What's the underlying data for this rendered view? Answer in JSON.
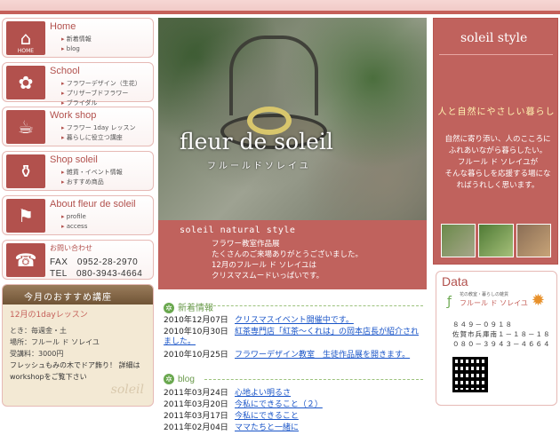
{
  "nav": [
    {
      "title": "Home",
      "icon": "house-icon",
      "icon_label": "HOME",
      "links": [
        "新着情報",
        "blog"
      ]
    },
    {
      "title": "School",
      "icon": "flower-icon",
      "icon_label": "",
      "links": [
        "フラワーデザイン（生花）",
        "プリザーブドフラワー",
        "ブライダル"
      ]
    },
    {
      "title": "Work shop",
      "icon": "cup-icon",
      "icon_label": "",
      "links": [
        "フラワー 1day レッスン",
        "暮らしに役立つ講座"
      ]
    },
    {
      "title": "Shop soleil",
      "icon": "watering-can-icon",
      "icon_label": "",
      "links": [
        "雑貨・イベント情報",
        "おすすめ商品"
      ]
    },
    {
      "title": "About fleur de soleil",
      "icon": "flag-icon",
      "icon_label": "",
      "links": [
        "profile",
        "access"
      ]
    }
  ],
  "contact": {
    "title": "お問い合わせ",
    "fax": "FAX　0952-28-2970",
    "tel": "TEL　080-3943-4664"
  },
  "course": {
    "heading": "今月のおすすめ講座",
    "title": "12月の1dayレッスン",
    "when": "とき：毎週金・土",
    "place": "場所：フルール ド ソレイユ",
    "fee": "受講料：3000円",
    "desc": "フレッシュもみの木でドア飾り！ 詳細はworkshopをご覧下さい",
    "watermark": "soleil"
  },
  "hero": {
    "title": "fleur de soleil",
    "subtitle": "フルールドソレイユ"
  },
  "natural": {
    "title": "soleil natural style",
    "lines": [
      "フラワー教室作品展",
      "たくさんのご来場ありがとうございました。",
      "12月のフルール ド ソレイユは",
      "クリスマスムードいっぱいです。"
    ]
  },
  "news": {
    "heading": "新着情報",
    "items": [
      {
        "date": "2010年12月07日",
        "title": "クリスマスイベント開催中です。"
      },
      {
        "date": "2010年10月30日",
        "title": "紅茶専門店「紅茶～くれは」の岡本店長が紹介されました。"
      },
      {
        "date": "2010年10月25日",
        "title": "フラワーデザイン教室　生徒作品展を開きます。"
      }
    ]
  },
  "blog": {
    "heading": "blog",
    "items": [
      {
        "date": "2011年03月24日",
        "title": "心地よい明るさ"
      },
      {
        "date": "2011年03月20日",
        "title": "今私にできること（２）"
      },
      {
        "date": "2011年03月17日",
        "title": "今私にできること"
      },
      {
        "date": "2011年02月04日",
        "title": "ママたちと一緒に"
      }
    ]
  },
  "style": {
    "title": "soleil style",
    "tagline": "人と自然にやさしい暮らし",
    "body": [
      "自然に寄り添い、人のこころに",
      "ふれあいながら暮らしたい。",
      "フルール ド ソレイユが",
      "そんな暮らしを応援する場にな",
      "ればうれしく思います。"
    ]
  },
  "data": {
    "title": "Data",
    "logo_small": "花の教室・暮らしの雑貨",
    "logo_main": "フルール ド ソレイユ",
    "zip": "８４９－０９１８",
    "address": "佐賀市兵庫南１－１８－１８",
    "tel": "０８０－３９４３－４６６４"
  },
  "colors": {
    "accent": "#c0625d",
    "green": "#6aa84f",
    "link": "#1a55c8"
  }
}
